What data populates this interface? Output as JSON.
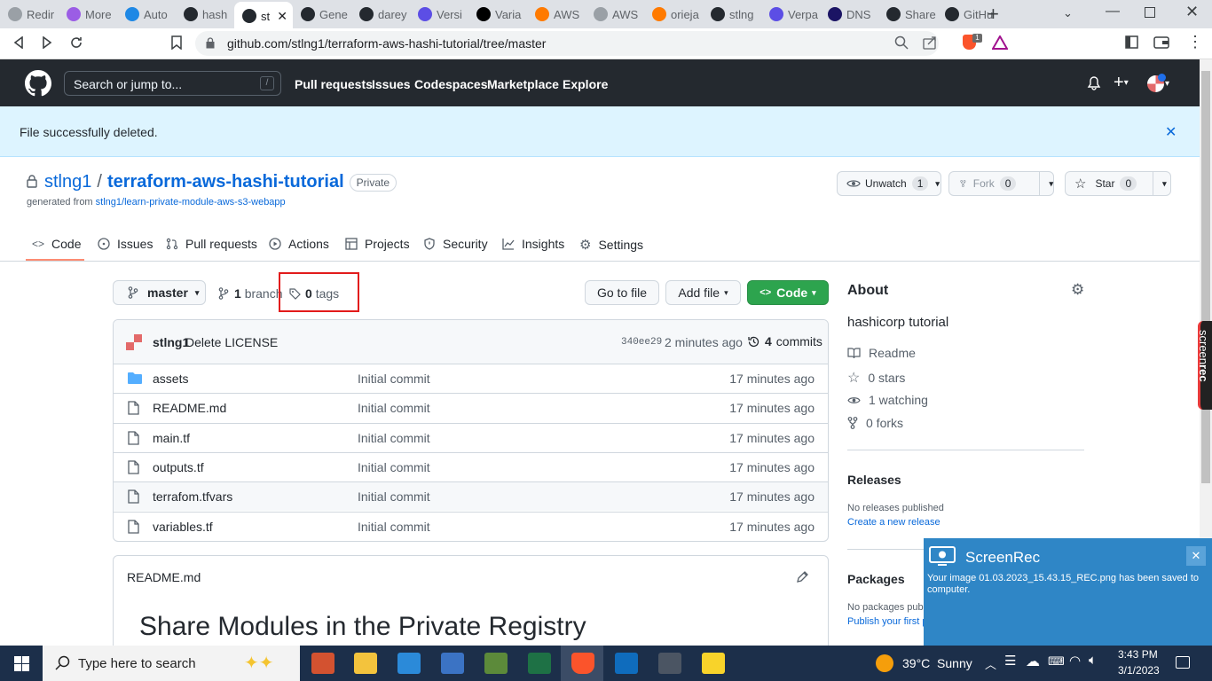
{
  "browser": {
    "tabs": [
      {
        "label": "Redir",
        "color": "#9aa0a6"
      },
      {
        "label": "More",
        "color": "#9b5de5"
      },
      {
        "label": "Auto",
        "color": "#1e88e5"
      },
      {
        "label": "hash",
        "color": "#24292f"
      },
      {
        "label": "st",
        "color": "#24292f",
        "active": true
      },
      {
        "label": "Gene",
        "color": "#24292f"
      },
      {
        "label": "darey",
        "color": "#24292f"
      },
      {
        "label": "Versi",
        "color": "#5c4ee5"
      },
      {
        "label": "Varia",
        "color": "#000000"
      },
      {
        "label": "AWS",
        "color": "#ff7a00"
      },
      {
        "label": "AWS",
        "color": "#9aa0a6"
      },
      {
        "label": "orieja",
        "color": "#ff7a00"
      },
      {
        "label": "stlng",
        "color": "#24292f"
      },
      {
        "label": "Verpa",
        "color": "#5c4ee5"
      },
      {
        "label": "DNS",
        "color": "#1b1464"
      },
      {
        "label": "Share",
        "color": "#24292f"
      },
      {
        "label": "GitHu",
        "color": "#24292f"
      }
    ],
    "new_tab": "+",
    "url": "github.com/stlng1/terraform-aws-hashi-tutorial/tree/master",
    "brave_badge": "1"
  },
  "github": {
    "search_placeholder": "Search or jump to...",
    "search_key": "/",
    "nav": [
      "Pull requests",
      "Issues",
      "Codespaces",
      "Marketplace",
      "Explore"
    ],
    "flash": "File successfully deleted.",
    "owner": "stlng1",
    "separator": "/",
    "repo": "terraform-aws-hashi-tutorial",
    "visibility": "Private",
    "generated_prefix": "generated from",
    "generated_link": "stlng1/learn-private-module-aws-s3-webapp",
    "watch": {
      "label": "Unwatch",
      "count": "1"
    },
    "fork": {
      "label": "Fork",
      "count": "0"
    },
    "star": {
      "label": "Star",
      "count": "0"
    },
    "repo_tabs": [
      "Code",
      "Issues",
      "Pull requests",
      "Actions",
      "Projects",
      "Security",
      "Insights",
      "Settings"
    ],
    "branch_select": "master",
    "branches": {
      "count": "1",
      "label": "branch"
    },
    "tags": {
      "count": "0",
      "label": "tags"
    },
    "goto_file": "Go to file",
    "add_file": "Add file",
    "code_btn": "Code",
    "commit": {
      "author": "stlng1",
      "message": "Delete LICENSE",
      "sha": "340ee29",
      "time": "2 minutes ago",
      "count": "4",
      "count_label": "commits"
    },
    "files": [
      {
        "name": "assets",
        "type": "dir",
        "message": "Initial commit",
        "age": "17 minutes ago"
      },
      {
        "name": "README.md",
        "type": "file",
        "message": "Initial commit",
        "age": "17 minutes ago"
      },
      {
        "name": "main.tf",
        "type": "file",
        "message": "Initial commit",
        "age": "17 minutes ago"
      },
      {
        "name": "outputs.tf",
        "type": "file",
        "message": "Initial commit",
        "age": "17 minutes ago"
      },
      {
        "name": "terrafom.tfvars",
        "type": "file",
        "message": "Initial commit",
        "age": "17 minutes ago"
      },
      {
        "name": "variables.tf",
        "type": "file",
        "message": "Initial commit",
        "age": "17 minutes ago"
      }
    ],
    "readme": {
      "filename": "README.md",
      "heading": "Share Modules in the Private Registry"
    },
    "about": {
      "title": "About",
      "description": "hashicorp tutorial",
      "readme": "Readme",
      "stars": "0 stars",
      "watching": "1 watching",
      "forks": "0 forks"
    },
    "releases": {
      "title": "Releases",
      "empty": "No releases published",
      "link": "Create a new release"
    },
    "packages": {
      "title": "Packages",
      "empty": "No packages publ",
      "link": "Publish your first p"
    }
  },
  "toast": {
    "app": "ScreenRec",
    "message": "Your image 01.03.2023_15.43.15_REC.png has been saved to computer."
  },
  "side_watermark": {
    "a": "screen",
    "b": "rec"
  },
  "taskbar": {
    "search_placeholder": "Type here to search",
    "weather": "39°C  Sunny",
    "time": "3:43 PM",
    "date": "3/1/2023"
  }
}
